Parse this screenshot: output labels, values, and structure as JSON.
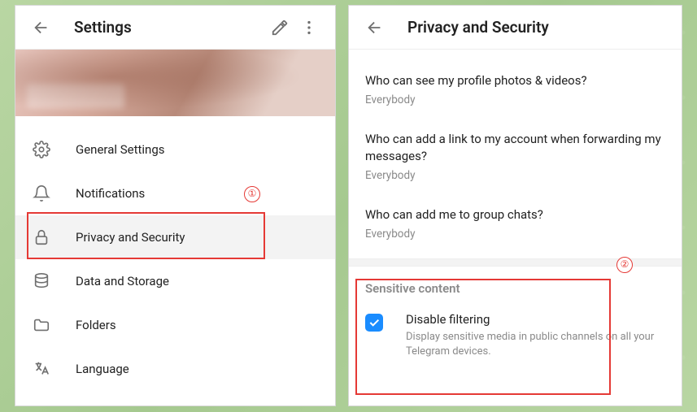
{
  "left": {
    "title": "Settings",
    "menu": [
      {
        "icon": "gear",
        "label": "General Settings"
      },
      {
        "icon": "bell",
        "label": "Notifications"
      },
      {
        "icon": "lock",
        "label": "Privacy and Security",
        "active": true
      },
      {
        "icon": "database",
        "label": "Data and Storage"
      },
      {
        "icon": "folder",
        "label": "Folders"
      },
      {
        "icon": "language",
        "label": "Language"
      }
    ]
  },
  "right": {
    "title": "Privacy and Security",
    "items": [
      {
        "title": "Who can see my profile photos & videos?",
        "value": "Everybody"
      },
      {
        "title": "Who can add a link to my account when forwarding my messages?",
        "value": "Everybody"
      },
      {
        "title": "Who can add me to group chats?",
        "value": "Everybody"
      }
    ],
    "section_title": "Sensitive content",
    "checkbox": {
      "title": "Disable filtering",
      "desc": "Display sensitive media in public channels on all your Telegram devices.",
      "checked": true
    }
  },
  "annotations": {
    "badge1": "①",
    "badge2": "②"
  }
}
